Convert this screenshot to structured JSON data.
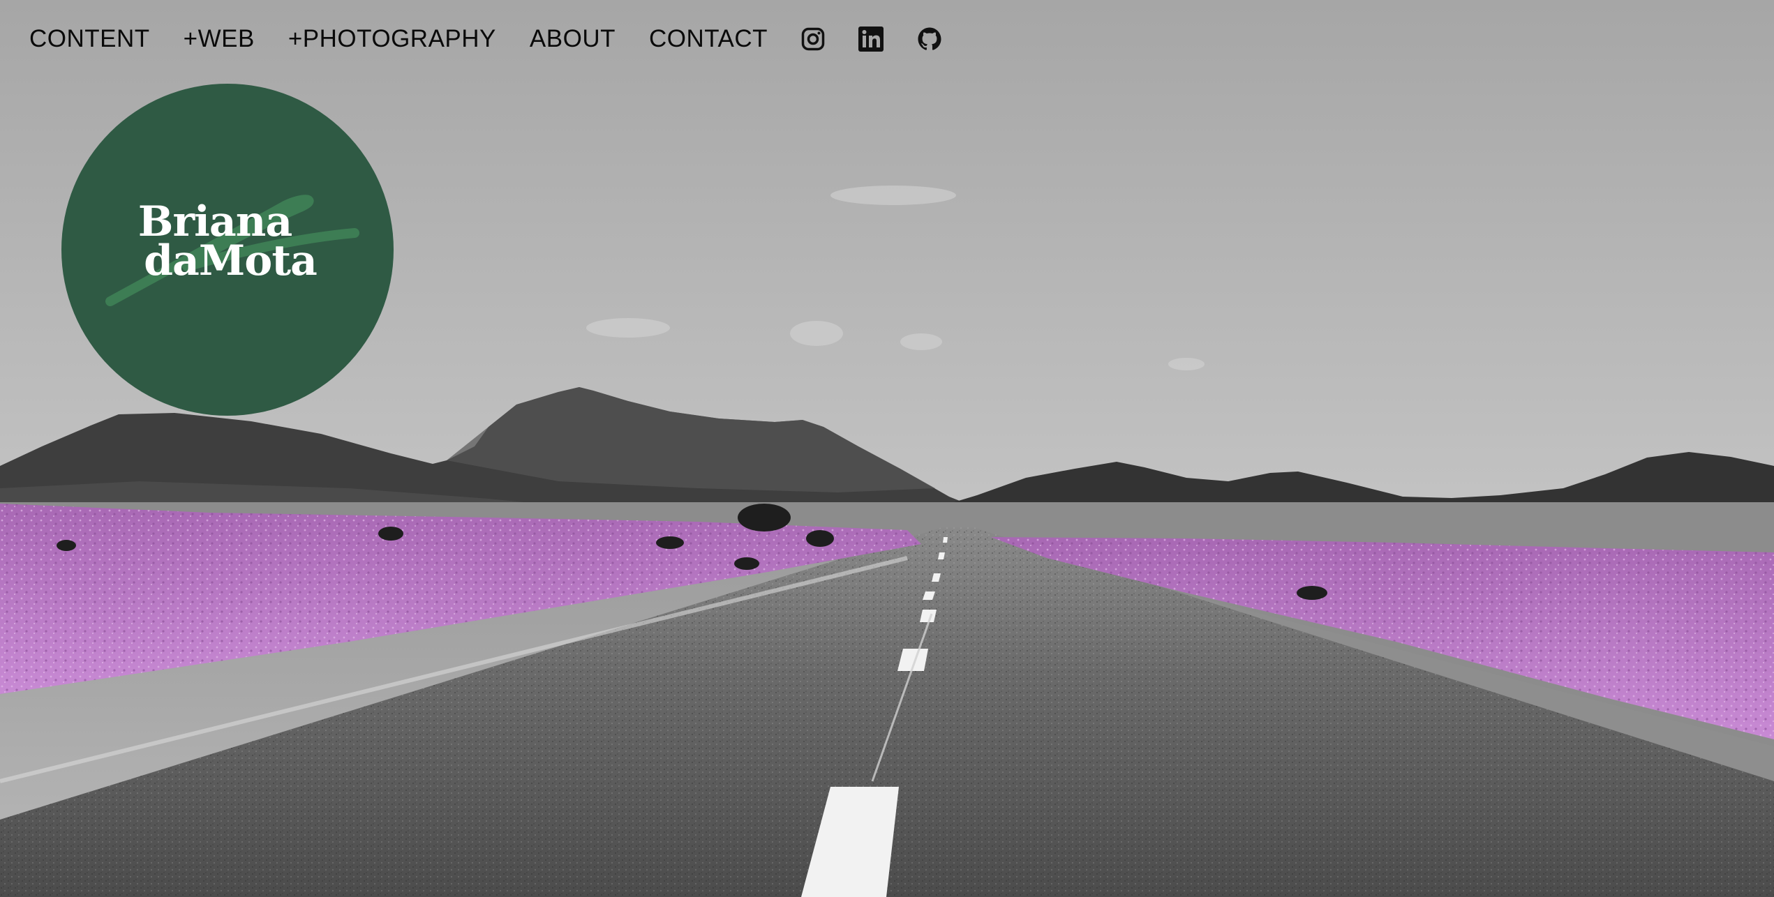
{
  "nav": {
    "items": [
      {
        "label": "CONTENT"
      },
      {
        "label": "+WEB"
      },
      {
        "label": "+PHOTOGRAPHY"
      },
      {
        "label": "ABOUT"
      },
      {
        "label": "CONTACT"
      }
    ],
    "social": [
      {
        "icon": "instagram-icon"
      },
      {
        "icon": "linkedin-icon"
      },
      {
        "icon": "github-icon"
      }
    ]
  },
  "logo": {
    "line1": "Briana",
    "line2": "daMota",
    "background": "#2f5a44",
    "accent": "#3e7f55"
  },
  "hero": {
    "flower_color": "#c27fd0",
    "sky_color": "#adadad"
  }
}
